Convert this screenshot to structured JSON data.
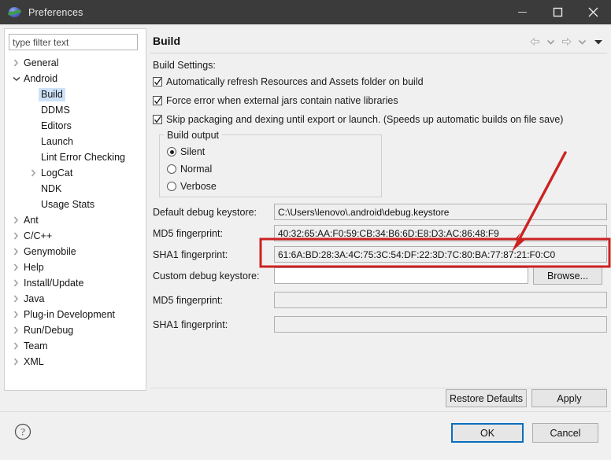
{
  "window": {
    "title": "Preferences",
    "icon": "eclipse-globe-icon",
    "minimize": "minimize-icon",
    "maximize": "maximize-icon",
    "close": "close-icon"
  },
  "sidebar": {
    "filter": {
      "placeholder": "type filter text",
      "value": ""
    },
    "items": [
      {
        "label": "General",
        "indent": 0,
        "expandable": true,
        "expanded": false,
        "selected": false
      },
      {
        "label": "Android",
        "indent": 0,
        "expandable": true,
        "expanded": true,
        "selected": false
      },
      {
        "label": "Build",
        "indent": 1,
        "expandable": false,
        "expanded": false,
        "selected": true
      },
      {
        "label": "DDMS",
        "indent": 1,
        "expandable": false,
        "expanded": false,
        "selected": false
      },
      {
        "label": "Editors",
        "indent": 1,
        "expandable": false,
        "expanded": false,
        "selected": false
      },
      {
        "label": "Launch",
        "indent": 1,
        "expandable": false,
        "expanded": false,
        "selected": false
      },
      {
        "label": "Lint Error Checking",
        "indent": 1,
        "expandable": false,
        "expanded": false,
        "selected": false
      },
      {
        "label": "LogCat",
        "indent": 1,
        "expandable": true,
        "expanded": false,
        "selected": false
      },
      {
        "label": "NDK",
        "indent": 1,
        "expandable": false,
        "expanded": false,
        "selected": false
      },
      {
        "label": "Usage Stats",
        "indent": 1,
        "expandable": false,
        "expanded": false,
        "selected": false
      },
      {
        "label": "Ant",
        "indent": 0,
        "expandable": true,
        "expanded": false,
        "selected": false
      },
      {
        "label": "C/C++",
        "indent": 0,
        "expandable": true,
        "expanded": false,
        "selected": false
      },
      {
        "label": "Genymobile",
        "indent": 0,
        "expandable": true,
        "expanded": false,
        "selected": false
      },
      {
        "label": "Help",
        "indent": 0,
        "expandable": true,
        "expanded": false,
        "selected": false
      },
      {
        "label": "Install/Update",
        "indent": 0,
        "expandable": true,
        "expanded": false,
        "selected": false
      },
      {
        "label": "Java",
        "indent": 0,
        "expandable": true,
        "expanded": false,
        "selected": false
      },
      {
        "label": "Plug-in Development",
        "indent": 0,
        "expandable": true,
        "expanded": false,
        "selected": false
      },
      {
        "label": "Run/Debug",
        "indent": 0,
        "expandable": true,
        "expanded": false,
        "selected": false
      },
      {
        "label": "Team",
        "indent": 0,
        "expandable": true,
        "expanded": false,
        "selected": false
      },
      {
        "label": "XML",
        "indent": 0,
        "expandable": true,
        "expanded": false,
        "selected": false
      }
    ]
  },
  "page": {
    "title": "Build",
    "nav": {
      "back": "back-arrow-icon",
      "back_dropdown": "chevron-down-icon",
      "forward": "forward-arrow-icon",
      "forward_dropdown": "chevron-down-icon",
      "menu": "view-menu-icon"
    },
    "settings_label": "Build Settings:",
    "checkboxes": [
      {
        "label": "Automatically refresh Resources and Assets folder on build",
        "checked": true
      },
      {
        "label": "Force error when external jars contain native libraries",
        "checked": true
      },
      {
        "label": "Skip packaging and dexing until export or launch. (Speeds up automatic builds on file save)",
        "checked": true
      }
    ],
    "build_output": {
      "group_label": "Build output",
      "options": [
        {
          "label": "Silent",
          "selected": true
        },
        {
          "label": "Normal",
          "selected": false
        },
        {
          "label": "Verbose",
          "selected": false
        }
      ]
    },
    "fields": [
      {
        "label": "Default debug keystore:",
        "value": "C:\\Users\\lenovo\\.android\\debug.keystore",
        "readonly": true
      },
      {
        "label": "MD5 fingerprint:",
        "value": "40:32:65:AA:F0:59:CB:34:B6:6D:E8:D3:AC:86:48:F9",
        "readonly": true
      },
      {
        "label": "SHA1 fingerprint:",
        "value": "61:6A:BD:28:3A:4C:75:3C:54:DF:22:3D:7C:80:BA:77:87:21:F0:C0",
        "readonly": true
      },
      {
        "label": "Custom debug keystore:",
        "value": "",
        "readonly": false
      },
      {
        "label": "MD5 fingerprint:",
        "value": "",
        "readonly": true
      },
      {
        "label": "SHA1 fingerprint:",
        "value": "",
        "readonly": true
      }
    ],
    "browse_label": "Browse...",
    "restore_defaults_label": "Restore Defaults",
    "apply_label": "Apply"
  },
  "footer": {
    "help": "help-icon",
    "ok_label": "OK",
    "cancel_label": "Cancel"
  },
  "annotations": {
    "highlight_color": "#cc2222",
    "highlight_target": "SHA1 fingerprint field",
    "arrow": "red-arrow-annotation",
    "box": "red-rectangle-annotation"
  },
  "colors": {
    "titlebar": "#3b3b3b",
    "dialog": "#f0f0f0",
    "selection": "#cde2f7",
    "default_button_border": "#0a6ebd",
    "annotation_red": "#cc2222"
  }
}
